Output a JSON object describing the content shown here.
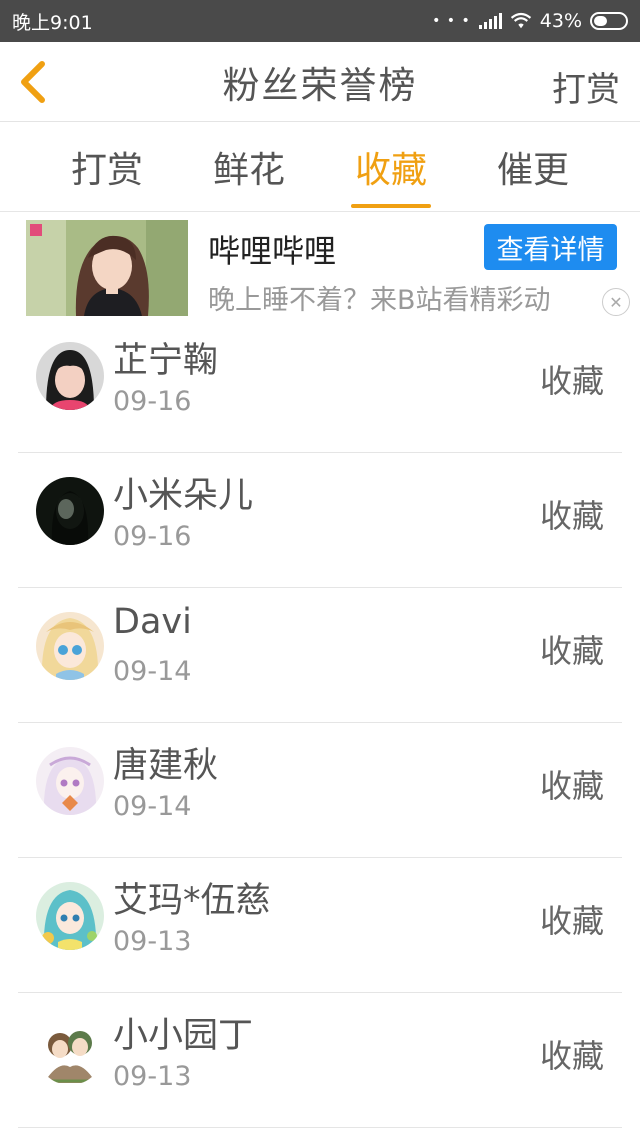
{
  "status_bar": {
    "time": "晚上9:01",
    "battery": "43%",
    "battery_level": 0.43
  },
  "header": {
    "title": "粉丝荣誉榜",
    "action_label": "打赏"
  },
  "tabs": [
    {
      "label": "打赏",
      "active": false
    },
    {
      "label": "鲜花",
      "active": false
    },
    {
      "label": "收藏",
      "active": true
    },
    {
      "label": "催更",
      "active": false
    }
  ],
  "ad": {
    "title": "哔哩哔哩",
    "description": "晚上睡不着？来B站看精彩动",
    "button_label": "查看详情",
    "close_symbol": "✕"
  },
  "fans": [
    {
      "name": "芷宁鞠",
      "date": "09-16",
      "action": "收藏"
    },
    {
      "name": "小米朵儿",
      "date": "09-16",
      "action": "收藏"
    },
    {
      "name": "Davi",
      "date": "09-14",
      "action": "收藏"
    },
    {
      "name": "唐建秋",
      "date": "09-14",
      "action": "收藏"
    },
    {
      "name": "艾玛*伍慈",
      "date": "09-13",
      "action": "收藏"
    },
    {
      "name": "小小园丁",
      "date": "09-13",
      "action": "收藏"
    }
  ],
  "colors": {
    "accent": "#f0a012",
    "ad_button": "#1e8cf0",
    "status_bar": "#4a4a4a"
  }
}
